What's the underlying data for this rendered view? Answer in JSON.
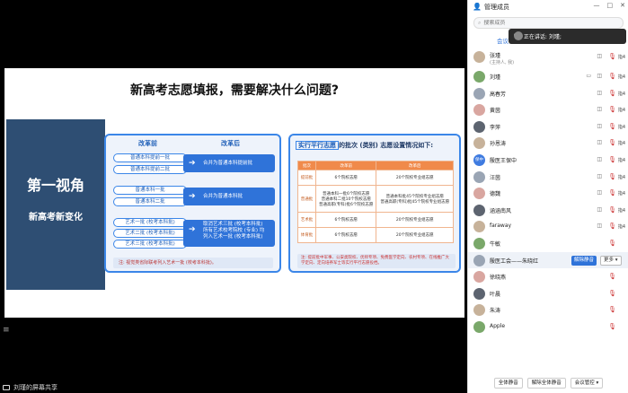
{
  "slide": {
    "title": "新高考志愿填报，需要解决什么问题?",
    "side_heading": "第一视角",
    "side_sub": "新高考新变化",
    "left": {
      "col_before": "改革前",
      "col_after": "改革后",
      "group1": [
        "普通本科提前一批",
        "普通本科提前二批"
      ],
      "result1": "合并为普通本科提前批",
      "group2": [
        "普通本科一批",
        "普通本科二批"
      ],
      "result2": "合并为普通本科批",
      "group3": [
        "艺术一批 (校考本科批)",
        "艺术二批 (校考本科批)",
        "艺术三批 (校考本科批)"
      ],
      "result3": [
        "取消艺术三批 (校考本科批)",
        "所有艺术校考院校 (专业) 均",
        "列入艺术一批 (校考本科批)"
      ],
      "note": "注: 视觉类省际联考列入艺术一批 (校考本科批)。"
    },
    "right": {
      "title_hl": "实行平行志愿",
      "title_rest": "的批次 (类别) 志愿设置情况如下:",
      "headers": [
        "批次",
        "改革前",
        "改革后"
      ],
      "rows": [
        {
          "k": "提前批",
          "before": "6个院校志愿",
          "after": "20个院校专业组志愿"
        },
        {
          "k": "普通批",
          "before": "普通本科一批6个院校志愿\n普通本科二批10个院校志愿\n普通高职(专科)批6个院校志愿",
          "after": "普通本科批45个院校专业组志愿\n普通高职(专科)批45个院校专业组志愿"
        },
        {
          "k": "艺术批",
          "before": "6个院校志愿",
          "after": "20个院校专业组志愿"
        },
        {
          "k": "体育批",
          "before": "6个院校志愿",
          "after": "20个院校专业组志愿"
        }
      ],
      "note": "注: 提前批中军事、公安类院校、优师专项、免费医学定向、农村专项、在线推广大学定向、定向培养军士等实行平行志愿投档。"
    }
  },
  "menu_icon": "≡",
  "bottom_bar": {
    "label": "刘瑾的屏幕共享"
  },
  "panel": {
    "title": "管理成员",
    "controls": [
      "—",
      "□",
      "✕"
    ],
    "search_placeholder": "搜索成员",
    "tab_active": "会议中",
    "speaking": "正在讲话: 刘瑾;",
    "members": [
      {
        "name": "张瑾",
        "sub": "(主持人, 我)",
        "cam": true,
        "mic_red": true,
        "label": "指4"
      },
      {
        "name": "刘瑾",
        "sub": "",
        "cam": true,
        "cam2": true,
        "mic_red": true,
        "label": "指4"
      },
      {
        "name": "高春芳",
        "sub": "",
        "cam": true,
        "mic_red": true,
        "label": "指4"
      },
      {
        "name": "黄茵",
        "sub": "",
        "cam": true,
        "mic_red": true,
        "label": "指4"
      },
      {
        "name": "李萍",
        "sub": "",
        "cam": true,
        "mic_red": true,
        "label": "指4"
      },
      {
        "name": "孙恩涛",
        "sub": "",
        "cam": true,
        "mic_red": true,
        "label": "指4"
      },
      {
        "name": "殷医王保中",
        "sub": "",
        "avatar_text": "保中",
        "cam": true,
        "mic_red": true,
        "label": "指4"
      },
      {
        "name": "汪茵",
        "sub": "",
        "cam": true,
        "mic_red": true,
        "label": "指4"
      },
      {
        "name": "德魏",
        "sub": "",
        "cam": true,
        "mic_red": true,
        "label": "指4"
      },
      {
        "name": "涵涵南风",
        "sub": "",
        "cam": true,
        "mic_red": true,
        "label": "指4"
      },
      {
        "name": "faraway",
        "sub": "",
        "cam": true,
        "mic_red": true,
        "label": "指4"
      },
      {
        "name": "牛敏",
        "sub": "",
        "cam": false,
        "mic_red": true,
        "label": ""
      },
      {
        "name": "殷医工会——朱晓红",
        "sub": "",
        "unmute_label": "解除静音",
        "more_label": "更多 ▾",
        "highlight": true
      },
      {
        "name": "徐晓燕",
        "sub": "",
        "cam": false,
        "mic_red": true,
        "label": ""
      },
      {
        "name": "叶晨",
        "sub": "",
        "cam": false,
        "mic_red": true,
        "label": ""
      },
      {
        "name": "朱涛",
        "sub": "",
        "cam": false,
        "mic_red": true,
        "label": ""
      },
      {
        "name": "Apple",
        "sub": "",
        "cam": false,
        "mic_red": true,
        "label": ""
      }
    ],
    "footer": [
      "全体静音",
      "解除全体静音",
      "会议管控 ▾"
    ]
  }
}
